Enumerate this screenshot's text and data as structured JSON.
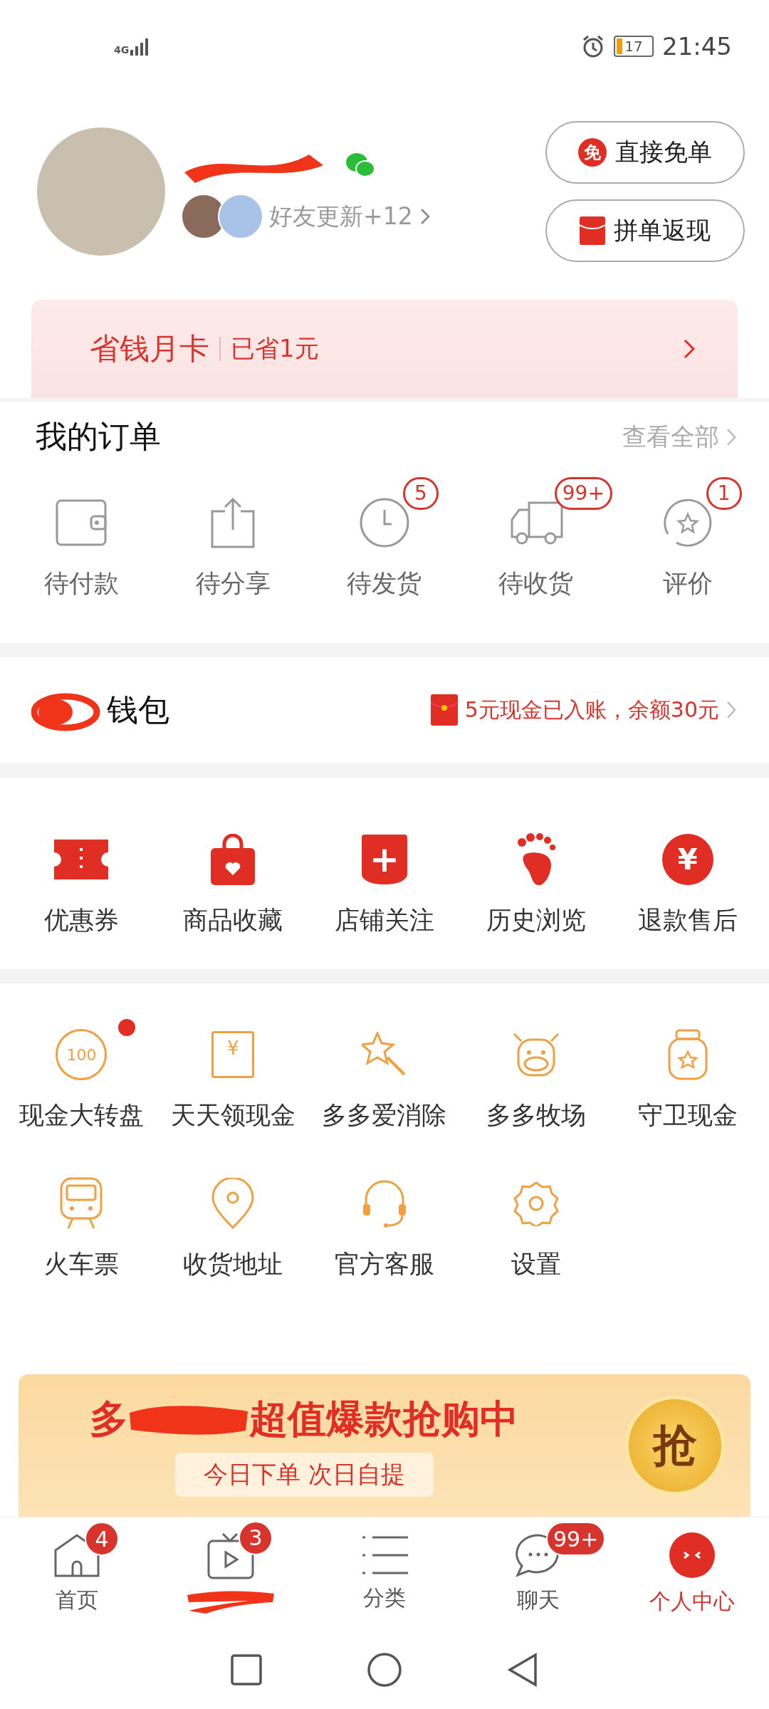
{
  "status_bar": {
    "network": "4G",
    "battery": "17",
    "time": "21:45"
  },
  "profile": {
    "friends_update": "好友更新+12",
    "buttons": [
      {
        "kind": "free",
        "label": "直接免单",
        "icon_text": "免"
      },
      {
        "kind": "redpacket",
        "label": "拼单返现"
      }
    ]
  },
  "savings_card": {
    "title": "省钱月卡",
    "saved": "已省1元"
  },
  "orders": {
    "title": "我的订单",
    "view_all": "查看全部",
    "items": [
      {
        "kind": "wallet",
        "label": "待付款"
      },
      {
        "kind": "share",
        "label": "待分享"
      },
      {
        "kind": "clock",
        "label": "待发货",
        "badge": "5"
      },
      {
        "kind": "truck",
        "label": "待收货",
        "badge": "99+"
      },
      {
        "kind": "review",
        "label": "评价",
        "badge": "1"
      }
    ]
  },
  "wallet": {
    "title": "钱包",
    "notice": "5元现金已入账，余额30元"
  },
  "services": [
    {
      "kind": "coupon",
      "label": "优惠券"
    },
    {
      "kind": "bag",
      "label": "商品收藏"
    },
    {
      "kind": "shop",
      "label": "店铺关注",
      "icon_text": "+"
    },
    {
      "kind": "foot",
      "label": "历史浏览"
    },
    {
      "kind": "yen",
      "label": "退款售后",
      "icon_text": "¥"
    }
  ],
  "tools": [
    {
      "kind": "wheel",
      "label": "现金大转盘",
      "icon_text": "100",
      "dot": true
    },
    {
      "kind": "envelope",
      "label": "天天领现金",
      "icon_text": "¥",
      "dot": false
    },
    {
      "kind": "wand",
      "label": "多多爱消除",
      "dot": false
    },
    {
      "kind": "cow",
      "label": "多多牧场",
      "dot": false
    },
    {
      "kind": "jar",
      "label": "守卫现金",
      "dot": false
    },
    {
      "kind": "train",
      "label": "火车票",
      "dot": false
    },
    {
      "kind": "pin",
      "label": "收货地址",
      "dot": false
    },
    {
      "kind": "headset",
      "label": "官方客服",
      "dot": false
    },
    {
      "kind": "gear",
      "label": "设置",
      "dot": false
    }
  ],
  "banner": {
    "title_start": "多",
    "title_end": "超值爆款抢购中",
    "subtitle": "今日下单 次日自提",
    "button": "抢"
  },
  "bottom_nav": [
    {
      "kind": "home",
      "label": "首页",
      "badge": "4",
      "selected": false
    },
    {
      "kind": "video",
      "badge": "3",
      "selected": false
    },
    {
      "kind": "list",
      "label": "分类",
      "selected": false
    },
    {
      "kind": "chat",
      "badge": "99+",
      "label": "聊天",
      "selected": false
    },
    {
      "kind": "me",
      "label": "个人中心",
      "selected": true
    }
  ]
}
